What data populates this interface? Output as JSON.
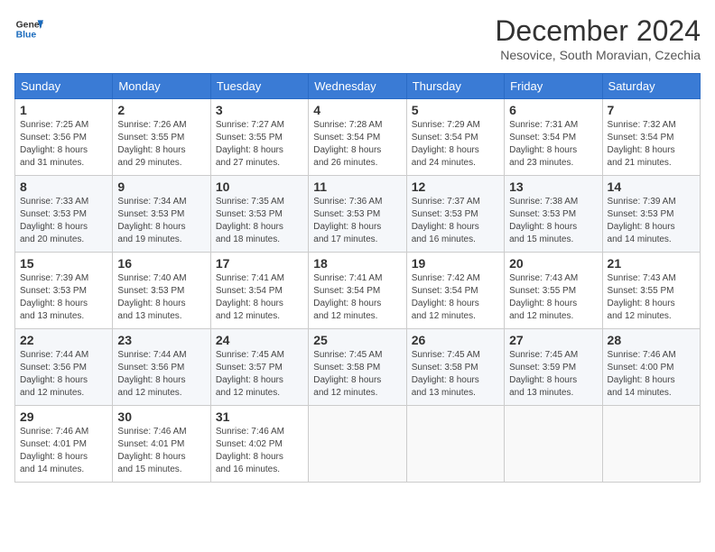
{
  "header": {
    "logo_line1": "General",
    "logo_line2": "Blue",
    "month_title": "December 2024",
    "subtitle": "Nesovice, South Moravian, Czechia"
  },
  "weekdays": [
    "Sunday",
    "Monday",
    "Tuesday",
    "Wednesday",
    "Thursday",
    "Friday",
    "Saturday"
  ],
  "weeks": [
    [
      {
        "day": "1",
        "info": "Sunrise: 7:25 AM\nSunset: 3:56 PM\nDaylight: 8 hours\nand 31 minutes."
      },
      {
        "day": "2",
        "info": "Sunrise: 7:26 AM\nSunset: 3:55 PM\nDaylight: 8 hours\nand 29 minutes."
      },
      {
        "day": "3",
        "info": "Sunrise: 7:27 AM\nSunset: 3:55 PM\nDaylight: 8 hours\nand 27 minutes."
      },
      {
        "day": "4",
        "info": "Sunrise: 7:28 AM\nSunset: 3:54 PM\nDaylight: 8 hours\nand 26 minutes."
      },
      {
        "day": "5",
        "info": "Sunrise: 7:29 AM\nSunset: 3:54 PM\nDaylight: 8 hours\nand 24 minutes."
      },
      {
        "day": "6",
        "info": "Sunrise: 7:31 AM\nSunset: 3:54 PM\nDaylight: 8 hours\nand 23 minutes."
      },
      {
        "day": "7",
        "info": "Sunrise: 7:32 AM\nSunset: 3:54 PM\nDaylight: 8 hours\nand 21 minutes."
      }
    ],
    [
      {
        "day": "8",
        "info": "Sunrise: 7:33 AM\nSunset: 3:53 PM\nDaylight: 8 hours\nand 20 minutes."
      },
      {
        "day": "9",
        "info": "Sunrise: 7:34 AM\nSunset: 3:53 PM\nDaylight: 8 hours\nand 19 minutes."
      },
      {
        "day": "10",
        "info": "Sunrise: 7:35 AM\nSunset: 3:53 PM\nDaylight: 8 hours\nand 18 minutes."
      },
      {
        "day": "11",
        "info": "Sunrise: 7:36 AM\nSunset: 3:53 PM\nDaylight: 8 hours\nand 17 minutes."
      },
      {
        "day": "12",
        "info": "Sunrise: 7:37 AM\nSunset: 3:53 PM\nDaylight: 8 hours\nand 16 minutes."
      },
      {
        "day": "13",
        "info": "Sunrise: 7:38 AM\nSunset: 3:53 PM\nDaylight: 8 hours\nand 15 minutes."
      },
      {
        "day": "14",
        "info": "Sunrise: 7:39 AM\nSunset: 3:53 PM\nDaylight: 8 hours\nand 14 minutes."
      }
    ],
    [
      {
        "day": "15",
        "info": "Sunrise: 7:39 AM\nSunset: 3:53 PM\nDaylight: 8 hours\nand 13 minutes."
      },
      {
        "day": "16",
        "info": "Sunrise: 7:40 AM\nSunset: 3:53 PM\nDaylight: 8 hours\nand 13 minutes."
      },
      {
        "day": "17",
        "info": "Sunrise: 7:41 AM\nSunset: 3:54 PM\nDaylight: 8 hours\nand 12 minutes."
      },
      {
        "day": "18",
        "info": "Sunrise: 7:41 AM\nSunset: 3:54 PM\nDaylight: 8 hours\nand 12 minutes."
      },
      {
        "day": "19",
        "info": "Sunrise: 7:42 AM\nSunset: 3:54 PM\nDaylight: 8 hours\nand 12 minutes."
      },
      {
        "day": "20",
        "info": "Sunrise: 7:43 AM\nSunset: 3:55 PM\nDaylight: 8 hours\nand 12 minutes."
      },
      {
        "day": "21",
        "info": "Sunrise: 7:43 AM\nSunset: 3:55 PM\nDaylight: 8 hours\nand 12 minutes."
      }
    ],
    [
      {
        "day": "22",
        "info": "Sunrise: 7:44 AM\nSunset: 3:56 PM\nDaylight: 8 hours\nand 12 minutes."
      },
      {
        "day": "23",
        "info": "Sunrise: 7:44 AM\nSunset: 3:56 PM\nDaylight: 8 hours\nand 12 minutes."
      },
      {
        "day": "24",
        "info": "Sunrise: 7:45 AM\nSunset: 3:57 PM\nDaylight: 8 hours\nand 12 minutes."
      },
      {
        "day": "25",
        "info": "Sunrise: 7:45 AM\nSunset: 3:58 PM\nDaylight: 8 hours\nand 12 minutes."
      },
      {
        "day": "26",
        "info": "Sunrise: 7:45 AM\nSunset: 3:58 PM\nDaylight: 8 hours\nand 13 minutes."
      },
      {
        "day": "27",
        "info": "Sunrise: 7:45 AM\nSunset: 3:59 PM\nDaylight: 8 hours\nand 13 minutes."
      },
      {
        "day": "28",
        "info": "Sunrise: 7:46 AM\nSunset: 4:00 PM\nDaylight: 8 hours\nand 14 minutes."
      }
    ],
    [
      {
        "day": "29",
        "info": "Sunrise: 7:46 AM\nSunset: 4:01 PM\nDaylight: 8 hours\nand 14 minutes."
      },
      {
        "day": "30",
        "info": "Sunrise: 7:46 AM\nSunset: 4:01 PM\nDaylight: 8 hours\nand 15 minutes."
      },
      {
        "day": "31",
        "info": "Sunrise: 7:46 AM\nSunset: 4:02 PM\nDaylight: 8 hours\nand 16 minutes."
      },
      null,
      null,
      null,
      null
    ]
  ]
}
